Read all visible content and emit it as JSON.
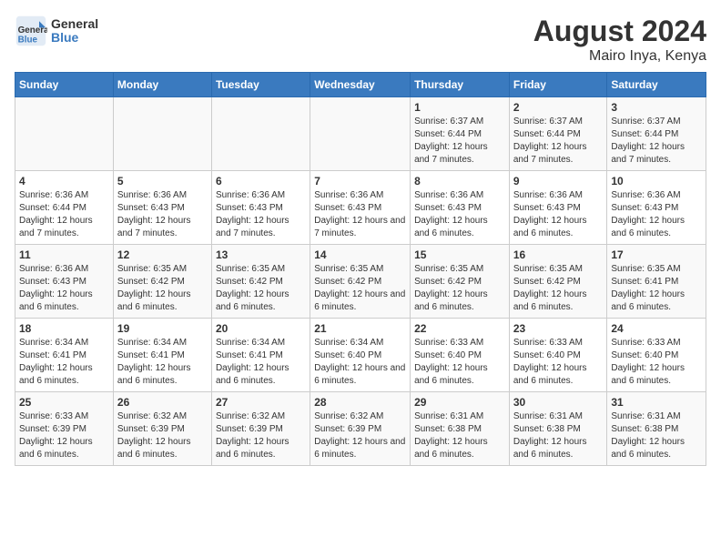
{
  "header": {
    "logo_general": "General",
    "logo_blue": "Blue",
    "title": "August 2024",
    "subtitle": "Mairo Inya, Kenya"
  },
  "days_of_week": [
    "Sunday",
    "Monday",
    "Tuesday",
    "Wednesday",
    "Thursday",
    "Friday",
    "Saturday"
  ],
  "weeks": [
    [
      {
        "day": "",
        "info": ""
      },
      {
        "day": "",
        "info": ""
      },
      {
        "day": "",
        "info": ""
      },
      {
        "day": "",
        "info": ""
      },
      {
        "day": "1",
        "info": "Sunrise: 6:37 AM\nSunset: 6:44 PM\nDaylight: 12 hours and 7 minutes."
      },
      {
        "day": "2",
        "info": "Sunrise: 6:37 AM\nSunset: 6:44 PM\nDaylight: 12 hours and 7 minutes."
      },
      {
        "day": "3",
        "info": "Sunrise: 6:37 AM\nSunset: 6:44 PM\nDaylight: 12 hours and 7 minutes."
      }
    ],
    [
      {
        "day": "4",
        "info": "Sunrise: 6:36 AM\nSunset: 6:44 PM\nDaylight: 12 hours and 7 minutes."
      },
      {
        "day": "5",
        "info": "Sunrise: 6:36 AM\nSunset: 6:43 PM\nDaylight: 12 hours and 7 minutes."
      },
      {
        "day": "6",
        "info": "Sunrise: 6:36 AM\nSunset: 6:43 PM\nDaylight: 12 hours and 7 minutes."
      },
      {
        "day": "7",
        "info": "Sunrise: 6:36 AM\nSunset: 6:43 PM\nDaylight: 12 hours and 7 minutes."
      },
      {
        "day": "8",
        "info": "Sunrise: 6:36 AM\nSunset: 6:43 PM\nDaylight: 12 hours and 6 minutes."
      },
      {
        "day": "9",
        "info": "Sunrise: 6:36 AM\nSunset: 6:43 PM\nDaylight: 12 hours and 6 minutes."
      },
      {
        "day": "10",
        "info": "Sunrise: 6:36 AM\nSunset: 6:43 PM\nDaylight: 12 hours and 6 minutes."
      }
    ],
    [
      {
        "day": "11",
        "info": "Sunrise: 6:36 AM\nSunset: 6:43 PM\nDaylight: 12 hours and 6 minutes."
      },
      {
        "day": "12",
        "info": "Sunrise: 6:35 AM\nSunset: 6:42 PM\nDaylight: 12 hours and 6 minutes."
      },
      {
        "day": "13",
        "info": "Sunrise: 6:35 AM\nSunset: 6:42 PM\nDaylight: 12 hours and 6 minutes."
      },
      {
        "day": "14",
        "info": "Sunrise: 6:35 AM\nSunset: 6:42 PM\nDaylight: 12 hours and 6 minutes."
      },
      {
        "day": "15",
        "info": "Sunrise: 6:35 AM\nSunset: 6:42 PM\nDaylight: 12 hours and 6 minutes."
      },
      {
        "day": "16",
        "info": "Sunrise: 6:35 AM\nSunset: 6:42 PM\nDaylight: 12 hours and 6 minutes."
      },
      {
        "day": "17",
        "info": "Sunrise: 6:35 AM\nSunset: 6:41 PM\nDaylight: 12 hours and 6 minutes."
      }
    ],
    [
      {
        "day": "18",
        "info": "Sunrise: 6:34 AM\nSunset: 6:41 PM\nDaylight: 12 hours and 6 minutes."
      },
      {
        "day": "19",
        "info": "Sunrise: 6:34 AM\nSunset: 6:41 PM\nDaylight: 12 hours and 6 minutes."
      },
      {
        "day": "20",
        "info": "Sunrise: 6:34 AM\nSunset: 6:41 PM\nDaylight: 12 hours and 6 minutes."
      },
      {
        "day": "21",
        "info": "Sunrise: 6:34 AM\nSunset: 6:40 PM\nDaylight: 12 hours and 6 minutes."
      },
      {
        "day": "22",
        "info": "Sunrise: 6:33 AM\nSunset: 6:40 PM\nDaylight: 12 hours and 6 minutes."
      },
      {
        "day": "23",
        "info": "Sunrise: 6:33 AM\nSunset: 6:40 PM\nDaylight: 12 hours and 6 minutes."
      },
      {
        "day": "24",
        "info": "Sunrise: 6:33 AM\nSunset: 6:40 PM\nDaylight: 12 hours and 6 minutes."
      }
    ],
    [
      {
        "day": "25",
        "info": "Sunrise: 6:33 AM\nSunset: 6:39 PM\nDaylight: 12 hours and 6 minutes."
      },
      {
        "day": "26",
        "info": "Sunrise: 6:32 AM\nSunset: 6:39 PM\nDaylight: 12 hours and 6 minutes."
      },
      {
        "day": "27",
        "info": "Sunrise: 6:32 AM\nSunset: 6:39 PM\nDaylight: 12 hours and 6 minutes."
      },
      {
        "day": "28",
        "info": "Sunrise: 6:32 AM\nSunset: 6:39 PM\nDaylight: 12 hours and 6 minutes."
      },
      {
        "day": "29",
        "info": "Sunrise: 6:31 AM\nSunset: 6:38 PM\nDaylight: 12 hours and 6 minutes."
      },
      {
        "day": "30",
        "info": "Sunrise: 6:31 AM\nSunset: 6:38 PM\nDaylight: 12 hours and 6 minutes."
      },
      {
        "day": "31",
        "info": "Sunrise: 6:31 AM\nSunset: 6:38 PM\nDaylight: 12 hours and 6 minutes."
      }
    ]
  ]
}
